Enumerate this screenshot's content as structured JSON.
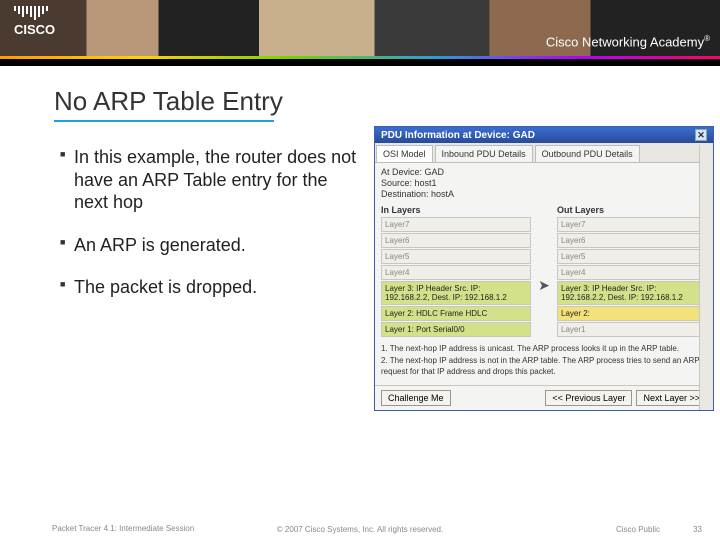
{
  "brand": {
    "name": "CISCO",
    "academy": "Cisco Networking Academy",
    "tm": "®"
  },
  "title": "No ARP Table Entry",
  "bullets": [
    "In this example, the router does not have an ARP Table entry for the next hop",
    "An ARP is generated.",
    "The packet is dropped."
  ],
  "pdu": {
    "window_title": "PDU Information at Device: GAD",
    "tabs": [
      "OSI Model",
      "Inbound PDU Details",
      "Outbound PDU Details"
    ],
    "active_tab": 0,
    "meta": {
      "device": "At Device: GAD",
      "source": "Source: host1",
      "dest": "Destination: hostA"
    },
    "in_label": "In Layers",
    "out_label": "Out Layers",
    "in_layers": [
      {
        "text": "Layer7",
        "state": "dim"
      },
      {
        "text": "Layer6",
        "state": "dim"
      },
      {
        "text": "Layer5",
        "state": "dim"
      },
      {
        "text": "Layer4",
        "state": "dim"
      },
      {
        "text": "Layer 3: IP Header Src. IP: 192.168.2.2, Dest. IP: 192.168.1.2",
        "state": "active"
      },
      {
        "text": "Layer 2: HDLC Frame HDLC",
        "state": "active"
      },
      {
        "text": "Layer 1: Port Serial0/0",
        "state": "active"
      }
    ],
    "out_layers": [
      {
        "text": "Layer7",
        "state": "dim"
      },
      {
        "text": "Layer6",
        "state": "dim"
      },
      {
        "text": "Layer5",
        "state": "dim"
      },
      {
        "text": "Layer4",
        "state": "dim"
      },
      {
        "text": "Layer 3: IP Header Src. IP: 192.168.2.2, Dest. IP: 192.168.1.2",
        "state": "active"
      },
      {
        "text": "Layer 2:",
        "state": "hl"
      },
      {
        "text": "Layer1",
        "state": "dim"
      }
    ],
    "notes": [
      "1. The next-hop IP address is unicast. The ARP process looks it up in the ARP table.",
      "2. The next-hop IP address is not in the ARP table. The ARP process tries to send an ARP request for that IP address and drops this packet."
    ],
    "buttons": {
      "challenge": "Challenge Me",
      "prev": "<< Previous Layer",
      "next": "Next Layer >>"
    }
  },
  "footer": {
    "left": "Packet Tracer 4.1: Intermediate Session",
    "center": "© 2007 Cisco Systems, Inc. All rights reserved.",
    "right1": "Cisco Public",
    "right2": "33"
  }
}
